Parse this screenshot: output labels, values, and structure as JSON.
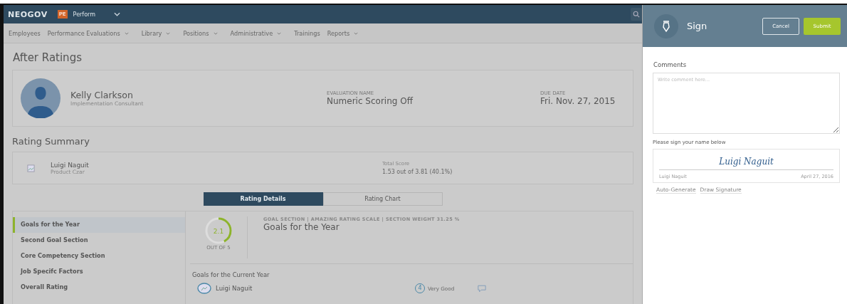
{
  "topbar": {
    "brand": "NEOGOV",
    "product_badge": "PE",
    "product": "Perform"
  },
  "nav": [
    {
      "label": "Employees",
      "dropdown": false
    },
    {
      "label": "Performance Evaluations",
      "dropdown": true
    },
    {
      "label": "Library",
      "dropdown": true
    },
    {
      "label": "Positions",
      "dropdown": true
    },
    {
      "label": "Administrative",
      "dropdown": true
    },
    {
      "label": "Trainings",
      "dropdown": false
    },
    {
      "label": "Reports",
      "dropdown": true
    }
  ],
  "page_title": "After Ratings",
  "employee": {
    "name": "Kelly Clarkson",
    "role": "Implementation Consultant",
    "fields": [
      {
        "label": "EVALUATION NAME",
        "value": "Numeric Scoring Off"
      },
      {
        "label": "DUE DATE",
        "value": "Fri. Nov. 27, 2015"
      }
    ]
  },
  "rating_summary": {
    "title": "Rating Summary",
    "rater": "Luigi Naguit",
    "rater_role": "Product Czar",
    "score_label": "Total Score",
    "score": "1.53 out of 3.81 (40.1%)"
  },
  "view_tabs": [
    {
      "label": "Rating Details",
      "selected": true
    },
    {
      "label": "Rating Chart",
      "selected": false
    }
  ],
  "sections": [
    {
      "label": "Goals for the Year",
      "selected": true
    },
    {
      "label": "Second Goal Section",
      "selected": false
    },
    {
      "label": "Core Competency Section",
      "selected": false
    },
    {
      "label": "Job Specifc Factors",
      "selected": false
    },
    {
      "label": "Overall Rating",
      "selected": false
    }
  ],
  "section_detail": {
    "score": "2.1",
    "out_of": "OUT OF 5",
    "meta": "GOAL SECTION | AMAZING RATING SCALE | SECTION WEIGHT 31.25 %",
    "title": "Goals for the Year",
    "subtitle": "Goals for the Current Year",
    "rater": "Luigi Naguit",
    "rating_number": "4",
    "rating_label": "Very Good"
  },
  "sign_panel": {
    "title": "Sign",
    "buttons": [
      {
        "label": "Cancel",
        "kind": "secondary"
      },
      {
        "label": "Submit",
        "kind": "primary"
      }
    ],
    "comments_label": "Comments",
    "comments_placeholder": "Write comment here...",
    "sign_prompt": "Please sign your name below",
    "signature": "Luigi Naguit",
    "signer": "Luigi Naguit",
    "sign_date": "April 27, 2016",
    "links": [
      "Auto-Generate",
      "Draw Signature"
    ]
  }
}
